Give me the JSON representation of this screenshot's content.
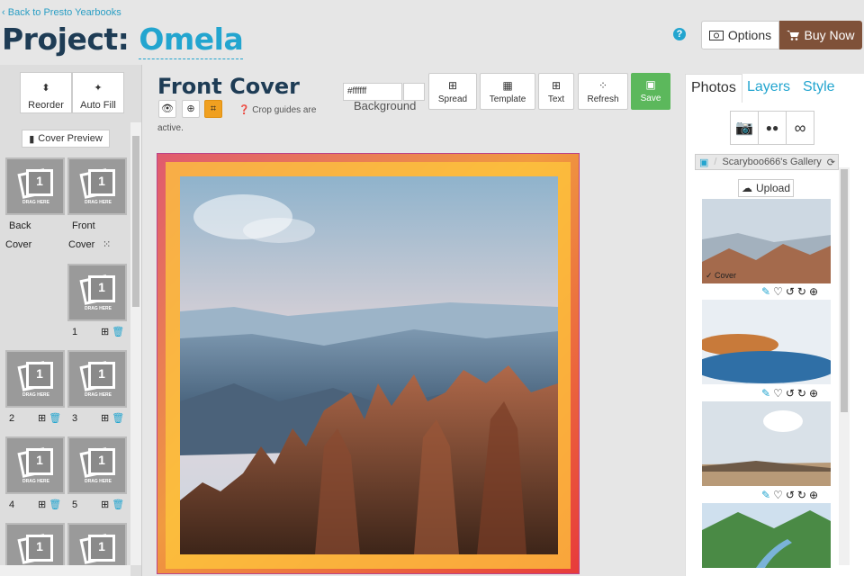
{
  "header": {
    "back_link": "Back to Presto Yearbooks",
    "title_prefix": "Project:",
    "project_name": "Omela",
    "help": "?",
    "options_label": "Options",
    "buy_label": "Buy Now",
    "buy_color": "#7f5139",
    "accent": "#23a5cf"
  },
  "left_panel": {
    "reorder": "Reorder",
    "autofill": "Auto Fill",
    "cover_preview": "Cover Preview",
    "thumb_num": "1",
    "drag_here": "DRAG HERE",
    "cover_back_l1": "Back",
    "cover_back_l2": "Cover",
    "cover_front_l1": "Front",
    "cover_front_l2": "Cover",
    "pages": [
      "1",
      "2",
      "3",
      "4",
      "5"
    ]
  },
  "center": {
    "title": "Front Cover",
    "crop_note": "Crop guides are",
    "active_note": "active.",
    "bg_value": "#ffffff",
    "bg_label": "Background",
    "toolbar": [
      {
        "label": "Spread",
        "icon": "spread-icon"
      },
      {
        "label": "Template",
        "icon": "template-icon"
      },
      {
        "label": "Text",
        "icon": "text-add-icon"
      },
      {
        "label": "Refresh",
        "icon": "refresh-icon"
      }
    ],
    "save": "Save"
  },
  "right_panel": {
    "tabs": [
      "Photos",
      "Layers",
      "Style"
    ],
    "gallery": "Scaryboo666's Gallery",
    "upload": "Upload",
    "cover_tag": "✓ Cover"
  }
}
